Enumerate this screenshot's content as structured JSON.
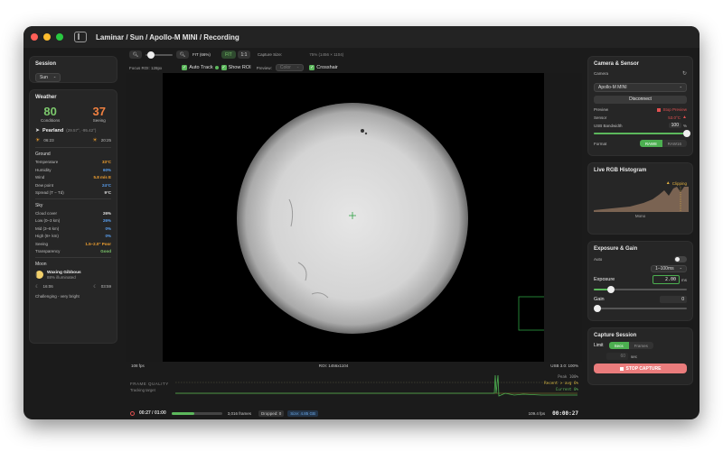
{
  "window": {
    "breadcrumb": "Laminar / Sun / Apollo-M MINI / Recording"
  },
  "session": {
    "title": "Session",
    "target": "Sun"
  },
  "weather": {
    "title": "Weather",
    "conditions_value": "80",
    "conditions_label": "Conditions",
    "seeing_value": "37",
    "seeing_label": "Seeing",
    "location": "Pearland",
    "coords": "(29.57°, -95.42°)",
    "sunrise": "06:23",
    "sunset": "20:25",
    "ground_title": "Ground",
    "ground": [
      {
        "label": "Temperature",
        "value": "33°C",
        "color": "#f0a030"
      },
      {
        "label": "Humidity",
        "value": "60%",
        "color": "#5aa0f0"
      },
      {
        "label": "Wind",
        "value": "5.8 m/s E",
        "color": "#f0a030"
      },
      {
        "label": "Dew point",
        "value": "24°C",
        "color": "#5aa0f0"
      },
      {
        "label": "Spread (T − Td)",
        "value": "9°C",
        "color": "#e0e0e0"
      }
    ],
    "sky_title": "Sky",
    "sky": [
      {
        "label": "Cloud cover",
        "value": "26%",
        "color": "#e0e0e0"
      },
      {
        "label": "Low (0–3 km)",
        "value": "26%",
        "color": "#5aa0f0"
      },
      {
        "label": "Mid (3–8 km)",
        "value": "0%",
        "color": "#5aa0f0"
      },
      {
        "label": "High (8+ km)",
        "value": "0%",
        "color": "#5aa0f0"
      },
      {
        "label": "Seeing",
        "value": "1.5–2.0\"  Poor",
        "color": "#f0a030"
      },
      {
        "label": "Transparency",
        "value": "Good",
        "color": "#7cc86c"
      }
    ],
    "moon_title": "Moon",
    "moon_phase": "Waxing Gibbous",
    "moon_illum": "88% illuminated",
    "moonrise": "16:06",
    "moonset": "03:59",
    "moon_note": "Challenging - very bright"
  },
  "toolbar": {
    "fit_label": "FIT (66%)",
    "fit_btn": "FIT",
    "one_btn": "1:1",
    "capture_size_label": "Capture Size:",
    "capture_size_value": "75% (1456 × 1104)"
  },
  "options": {
    "focus_roi": "Focus ROI: 128px",
    "auto_track": "Auto Track",
    "show_roi": "Show ROI",
    "preview_label": "Preview:",
    "preview_value": "Color",
    "crosshair": "Crosshair"
  },
  "status": {
    "fps": "108 fps",
    "roi": "ROI: 1456x1104",
    "usb": "USB 3.0: 100%"
  },
  "frame_quality": {
    "title": "FRAME QUALITY",
    "subtitle": "Tracking target",
    "peak": "Peak 100%",
    "recent": "Recent > avg 6%",
    "current": "Current 0%"
  },
  "bottom": {
    "elapsed": "00:27 / 01:00",
    "progress": 0.45,
    "frames": "3,016 frames",
    "dropped": "Dropped: 0",
    "size": "Size: 4.85 GB",
    "rate": "109.4 fps",
    "timer": "00:00:27"
  },
  "camera": {
    "title": "Camera & Sensor",
    "camera_label": "Camera",
    "camera_value": "Apollo-M MINI",
    "disconnect": "Disconnect",
    "preview_label": "Preview",
    "stop_preview": "Stop Preview",
    "sensor_label": "Sensor",
    "sensor_value": "53.0°C",
    "usb_label": "USB Bandwidth",
    "usb_value": "100",
    "usb_unit": "%",
    "usb_level": 1.0,
    "format_label": "Format",
    "format_a": "RAW8",
    "format_b": "RAW16"
  },
  "histogram": {
    "title": "Live RGB Histogram",
    "clipping": "Clipping",
    "mode": "Mono"
  },
  "exposure": {
    "title": "Exposure & Gain",
    "auto_label": "Auto",
    "range": "1–100ms",
    "exposure_label": "Exposure",
    "exposure_value": "2.00",
    "exposure_unit": "ms",
    "exposure_level": 0.18,
    "gain_label": "Gain",
    "gain_value": "0",
    "gain_level": 0.0
  },
  "capture": {
    "title": "Capture Session",
    "limit_label": "Limit",
    "limit_a": "Secs",
    "limit_b": "Frames",
    "limit_value": "60",
    "limit_unit": "sec",
    "stop_button": "STOP CAPTURE"
  }
}
